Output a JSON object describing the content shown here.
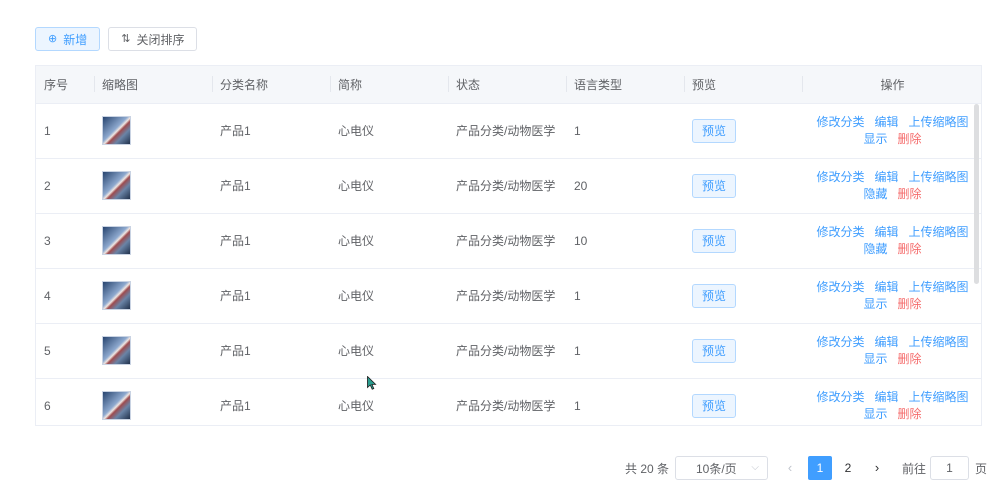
{
  "toolbar": {
    "add_label": "新增",
    "add_icon": "plus-circle-icon",
    "sort_label": "关闭排序",
    "sort_icon": "sort-icon"
  },
  "table": {
    "columns": [
      "序号",
      "缩略图",
      "分类名称",
      "简称",
      "状态",
      "语言类型",
      "预览",
      "操作"
    ],
    "preview_label": "预览",
    "actions": {
      "modify": "修改分类",
      "edit": "编辑",
      "upload": "上传缩略图",
      "delete": "删除"
    },
    "rows": [
      {
        "index": "1",
        "name": "产品1",
        "short": "心电仪",
        "status": "产品分类/动物医学",
        "lang": "1",
        "toggle": "显示"
      },
      {
        "index": "2",
        "name": "产品1",
        "short": "心电仪",
        "status": "产品分类/动物医学",
        "lang": "20",
        "toggle": "隐藏"
      },
      {
        "index": "3",
        "name": "产品1",
        "short": "心电仪",
        "status": "产品分类/动物医学",
        "lang": "10",
        "toggle": "隐藏"
      },
      {
        "index": "4",
        "name": "产品1",
        "short": "心电仪",
        "status": "产品分类/动物医学",
        "lang": "1",
        "toggle": "显示"
      },
      {
        "index": "5",
        "name": "产品1",
        "short": "心电仪",
        "status": "产品分类/动物医学",
        "lang": "1",
        "toggle": "显示"
      },
      {
        "index": "6",
        "name": "产品1",
        "short": "心电仪",
        "status": "产品分类/动物医学",
        "lang": "1",
        "toggle": "显示"
      }
    ]
  },
  "pagination": {
    "total_text": "共 20 条",
    "page_size": "10条/页",
    "pages": [
      "1",
      "2"
    ],
    "current_page": "1",
    "goto_label": "前往",
    "goto_value": "1",
    "page_unit": "页"
  },
  "colors": {
    "primary": "#409eff",
    "danger": "#f56c6c",
    "header_bg": "#f5f7fa"
  }
}
